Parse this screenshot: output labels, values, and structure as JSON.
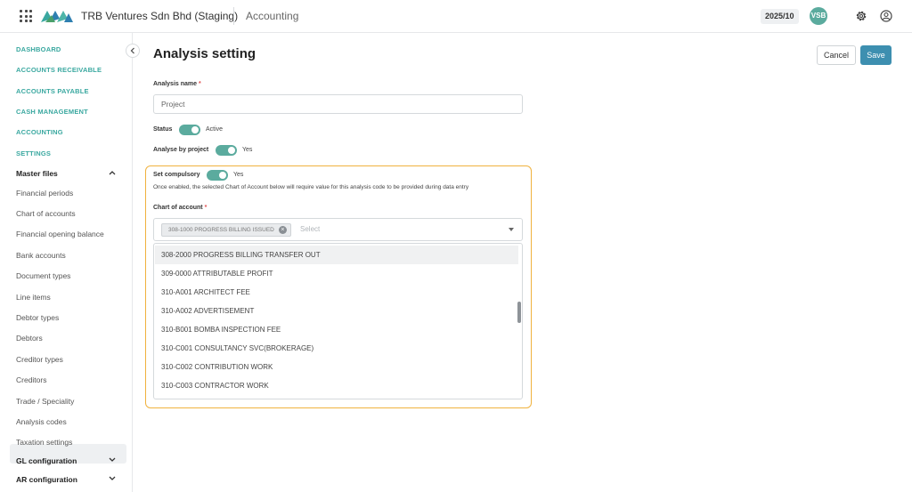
{
  "topbar": {
    "company": "TRB Ventures Sdn Bhd (Staging)",
    "module": "Accounting",
    "period": "2025/10",
    "avatar_initials": "VSB",
    "accent_color": "#5bab9e"
  },
  "sidebar": {
    "top_links": [
      "DASHBOARD",
      "ACCOUNTS RECEIVABLE",
      "ACCOUNTS PAYABLE",
      "CASH MANAGEMENT",
      "ACCOUNTING",
      "SETTINGS"
    ],
    "master_files_label": "Master files",
    "items": [
      "Financial periods",
      "Chart of accounts",
      "Financial opening balance",
      "Bank accounts",
      "Document types",
      "Line items",
      "Debtor types",
      "Debtors",
      "Creditor types",
      "Creditors",
      "Trade / Speciality",
      "Analysis codes",
      "Taxation settings"
    ],
    "active_item": "Analysis codes",
    "gl_config_label": "GL configuration",
    "ar_config_label": "AR configuration"
  },
  "page": {
    "title": "Analysis setting",
    "cancel_label": "Cancel",
    "save_label": "Save",
    "analysis_name_label": "Analysis name",
    "analysis_name_value": "Project",
    "status_label": "Status",
    "status_value": "Active",
    "analyse_by_project_label": "Analyse by project",
    "analyse_by_project_value": "Yes",
    "set_compulsory_label": "Set compulsory",
    "set_compulsory_value": "Yes",
    "compulsory_hint": "Once enabled, the selected Chart of Account below will require value for this analysis code to be provided during data entry",
    "chart_of_account_label": "Chart of account",
    "selected_chip": "308-1000 PROGRESS BILLING ISSUED",
    "select_placeholder": "Select",
    "dropdown_options": [
      "308-2000 PROGRESS BILLING TRANSFER OUT",
      "309-0000 ATTRIBUTABLE PROFIT",
      "310-A001 ARCHITECT FEE",
      "310-A002 ADVERTISEMENT",
      "310-B001 BOMBA INSPECTION FEE",
      "310-C001 CONSULTANCY SVC(BROKERAGE)",
      "310-C002 CONTRIBUTION WORK",
      "310-C003 CONTRACTOR WORK"
    ],
    "required_mark": "*"
  }
}
